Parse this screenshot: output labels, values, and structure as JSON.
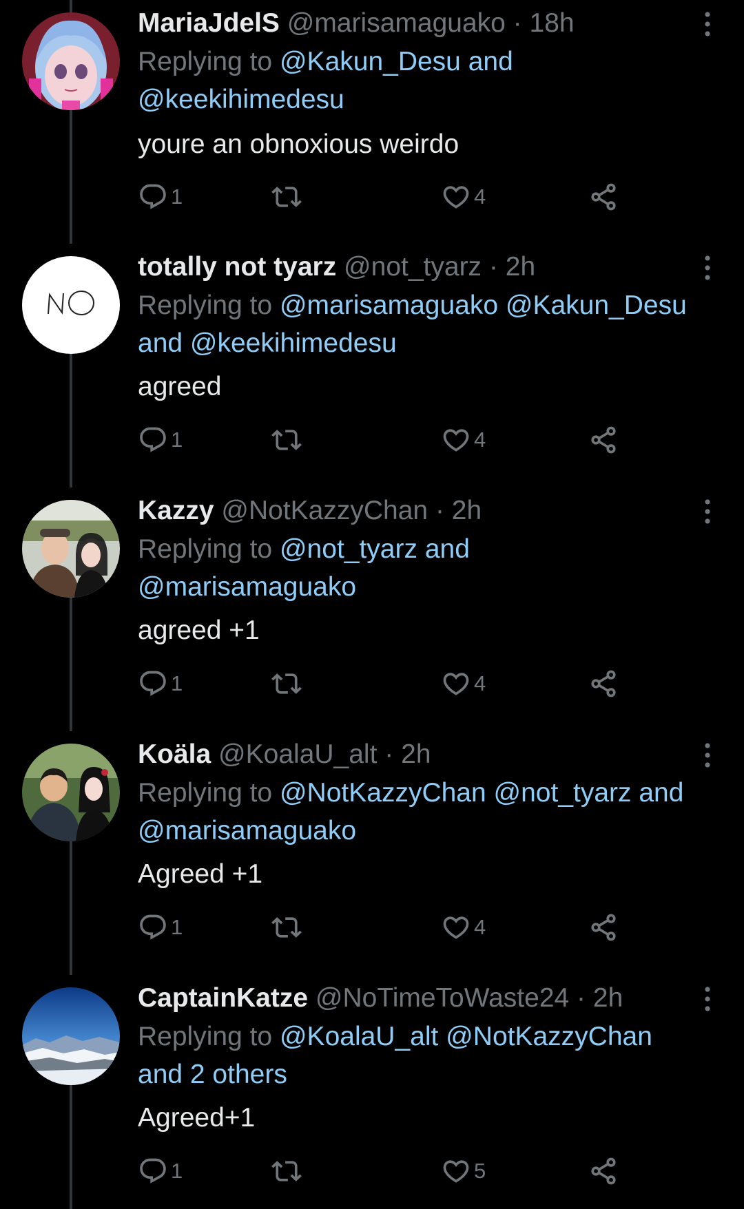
{
  "tweets": [
    {
      "name": "MariaJdelS",
      "handle": "@marisamaguako",
      "dot": "·",
      "time": "18h",
      "replying_prefix": "Replying to",
      "replying_to": "@Kakun_Desu and @keekihimedesu",
      "text": "youre an obnoxious weirdo",
      "replies": "1",
      "retweets": "",
      "likes": "4",
      "avatar": "anime-avatar"
    },
    {
      "name": "totally not tyarz",
      "handle": "@not_tyarz",
      "dot": "·",
      "time": "2h",
      "replying_prefix": "Replying to",
      "replying_to": "@marisamaguako @Kakun_Desu and @keekihimedesu",
      "text": "agreed",
      "replies": "1",
      "retweets": "",
      "likes": "4",
      "avatar": "no-avatar",
      "avatar_text": "NO"
    },
    {
      "name": "Kazzy",
      "handle": "@NotKazzyChan",
      "dot": "·",
      "time": "2h",
      "replying_prefix": "Replying to",
      "replying_to": "@not_tyarz and @marisamaguako",
      "text": "agreed +1",
      "replies": "1",
      "retweets": "",
      "likes": "4",
      "avatar": "photo-avatar"
    },
    {
      "name": "Koäla",
      "handle": "@KoalaU_alt",
      "dot": "·",
      "time": "2h",
      "replying_prefix": "Replying to",
      "replying_to": "@NotKazzyChan @not_tyarz and @marisamaguako",
      "text": "Agreed +1",
      "replies": "1",
      "retweets": "",
      "likes": "4",
      "avatar": "photo-avatar"
    },
    {
      "name": "CaptainKatze",
      "handle": "@NoTimeToWaste24",
      "dot": "·",
      "time": "2h",
      "replying_prefix": "Replying to",
      "replying_to": "@KoalaU_alt @NotKazzyChan and 2 others",
      "text": "Agreed+1",
      "replies": "1",
      "retweets": "",
      "likes": "5",
      "avatar": "mountain-avatar"
    }
  ],
  "colors": {
    "background": "#000000",
    "text_primary": "#e7e9ea",
    "text_secondary": "#71767b",
    "mention": "#8ecdf8",
    "thread_line": "#333639"
  }
}
